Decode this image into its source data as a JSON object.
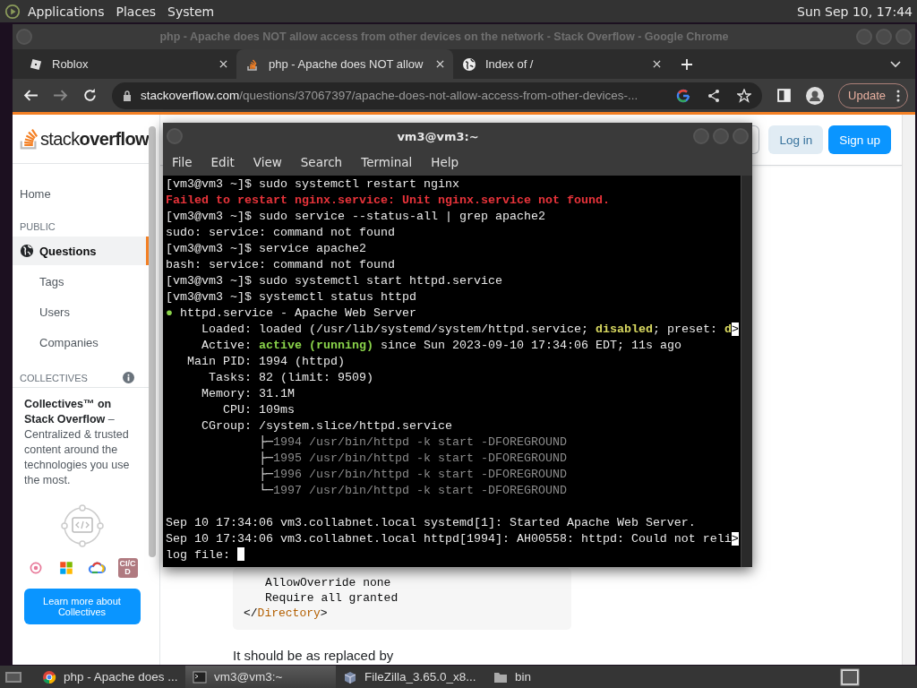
{
  "top_panel": {
    "menus": [
      "Applications",
      "Places",
      "System"
    ],
    "clock": "Sun Sep 10, 17:44"
  },
  "browser": {
    "title": "php - Apache does NOT allow access from other devices on the network - Stack Overflow - Google Chrome",
    "tabs": [
      {
        "label": "Roblox",
        "selected": false,
        "kind": "square"
      },
      {
        "label": "php - Apache does NOT allow",
        "selected": true,
        "kind": "stack"
      },
      {
        "label": "Index of /",
        "selected": false,
        "kind": "globe"
      }
    ],
    "address": {
      "domain": "stackoverflow.com",
      "path": "/questions/37067397/apache-does-not-allow-access-from-other-devices-..."
    },
    "update_button": "Update"
  },
  "sidebar": {
    "logo": "stack**overflow**",
    "home": {
      "label": "Home",
      "selected": false
    },
    "public_heading": "PUBLIC",
    "items": [
      {
        "label": "Questions",
        "selected": true,
        "kind": "globe"
      },
      {
        "label": "Tags",
        "selected": false,
        "kind": "plain"
      },
      {
        "label": "Users",
        "selected": false,
        "kind": "plain"
      },
      {
        "label": "Companies",
        "selected": false,
        "kind": "plain"
      }
    ],
    "collectives_heading": "COLLECTIVES",
    "collectives_text": "**Collectives™ on Stack Overflow** – Centralized & trusted content around the technologies you use the most.",
    "badge": "CI/CD",
    "learn_button": "Learn more about Collectives"
  },
  "header": {
    "login": "Log in",
    "signup": "Sign up"
  },
  "content": {
    "code_lines": [
      {
        "indented": true,
        "segments": [
          {
            "kind": "plain",
            "text": "AllowOverride none"
          }
        ]
      },
      {
        "indented": true,
        "segments": [
          {
            "kind": "plain",
            "text": "Require all granted"
          }
        ]
      },
      {
        "indented": false,
        "segments": [
          {
            "kind": "plain",
            "text": "</"
          },
          {
            "kind": "tag",
            "text": "Directory"
          },
          {
            "kind": "plain",
            "text": ">"
          }
        ]
      }
    ],
    "text": "It should be as replaced by"
  },
  "terminal": {
    "title": "vm3@vm3:~",
    "menu": [
      "File",
      "Edit",
      "View",
      "Search",
      "Terminal",
      "Help"
    ],
    "lines": [
      {
        "kind": "text",
        "segments": [
          {
            "kind": "plain",
            "text": "[vm3@vm3 ~]$ sudo systemctl restart nginx"
          }
        ]
      },
      {
        "kind": "text",
        "segments": [
          {
            "kind": "error",
            "text": "Failed to restart nginx.service: Unit nginx.service not found."
          }
        ]
      },
      {
        "kind": "text",
        "segments": [
          {
            "kind": "plain",
            "text": "[vm3@vm3 ~]$ sudo service --status-all | grep apache2"
          }
        ]
      },
      {
        "kind": "text",
        "segments": [
          {
            "kind": "plain",
            "text": "sudo: service: command not found"
          }
        ]
      },
      {
        "kind": "text",
        "segments": [
          {
            "kind": "plain",
            "text": "[vm3@vm3 ~]$ service apache2"
          }
        ]
      },
      {
        "kind": "text",
        "segments": [
          {
            "kind": "plain",
            "text": "bash: service: command not found"
          }
        ]
      },
      {
        "kind": "text",
        "segments": [
          {
            "kind": "plain",
            "text": "[vm3@vm3 ~]$ sudo systemctl start httpd.service"
          }
        ]
      },
      {
        "kind": "text",
        "segments": [
          {
            "kind": "plain",
            "text": "[vm3@vm3 ~]$ systemctl status httpd"
          }
        ]
      },
      {
        "kind": "text",
        "segments": [
          {
            "kind": "dot",
            "text": "●"
          },
          {
            "kind": "plain",
            "text": " httpd.service - Apache Web Server"
          }
        ]
      },
      {
        "kind": "text",
        "segments": [
          {
            "kind": "plain",
            "text": "     Loaded: loaded (/usr/lib/systemd/system/httpd.service; "
          },
          {
            "kind": "warn",
            "text": "disabled"
          },
          {
            "kind": "plain",
            "text": "; preset: "
          },
          {
            "kind": "warn",
            "text": "d"
          },
          {
            "kind": "more",
            "text": ">"
          }
        ]
      },
      {
        "kind": "text",
        "segments": [
          {
            "kind": "plain",
            "text": "     Active: "
          },
          {
            "kind": "ok",
            "text": "active (running)"
          },
          {
            "kind": "plain",
            "text": " since Sun 2023-09-10 17:34:06 EDT; 11s ago"
          }
        ]
      },
      {
        "kind": "text",
        "segments": [
          {
            "kind": "plain",
            "text": "   Main PID: 1994 (httpd)"
          }
        ]
      },
      {
        "kind": "text",
        "segments": [
          {
            "kind": "plain",
            "text": "      Tasks: 82 (limit: 9509)"
          }
        ]
      },
      {
        "kind": "text",
        "segments": [
          {
            "kind": "plain",
            "text": "     Memory: 31.1M"
          }
        ]
      },
      {
        "kind": "text",
        "segments": [
          {
            "kind": "plain",
            "text": "        CPU: 109ms"
          }
        ]
      },
      {
        "kind": "text",
        "segments": [
          {
            "kind": "plain",
            "text": "     CGroup: /system.slice/httpd.service"
          }
        ]
      },
      {
        "kind": "text",
        "segments": [
          {
            "kind": "plain",
            "text": "             ├─"
          },
          {
            "kind": "dim",
            "text": "1994 /usr/bin/httpd -k start -DFOREGROUND"
          }
        ]
      },
      {
        "kind": "text",
        "segments": [
          {
            "kind": "plain",
            "text": "             ├─"
          },
          {
            "kind": "dim",
            "text": "1995 /usr/bin/httpd -k start -DFOREGROUND"
          }
        ]
      },
      {
        "kind": "text",
        "segments": [
          {
            "kind": "plain",
            "text": "             ├─"
          },
          {
            "kind": "dim",
            "text": "1996 /usr/bin/httpd -k start -DFOREGROUND"
          }
        ]
      },
      {
        "kind": "text",
        "segments": [
          {
            "kind": "plain",
            "text": "             └─"
          },
          {
            "kind": "dim",
            "text": "1997 /usr/bin/httpd -k start -DFOREGROUND"
          }
        ]
      },
      {
        "kind": "blank"
      },
      {
        "kind": "text",
        "segments": [
          {
            "kind": "plain",
            "text": "Sep 10 17:34:06 vm3.collabnet.local systemd[1]: Started Apache Web Server."
          }
        ]
      },
      {
        "kind": "text",
        "segments": [
          {
            "kind": "plain",
            "text": "Sep 10 17:34:06 vm3.collabnet.local httpd[1994]: AH00558: httpd: Could not reli"
          },
          {
            "kind": "more",
            "text": ">"
          }
        ]
      },
      {
        "kind": "text",
        "cursor": true,
        "segments": [
          {
            "kind": "plain",
            "text": "log file: "
          }
        ]
      }
    ]
  },
  "taskbar": {
    "items": [
      {
        "label": "php - Apache does ...",
        "selected": false,
        "kind": "browser"
      },
      {
        "label": "vm3@vm3:~",
        "selected": true,
        "kind": "terminal"
      },
      {
        "label": "FileZilla_3.65.0_x8...",
        "selected": false,
        "kind": "package"
      },
      {
        "label": "bin",
        "selected": false,
        "kind": "folder"
      }
    ]
  }
}
